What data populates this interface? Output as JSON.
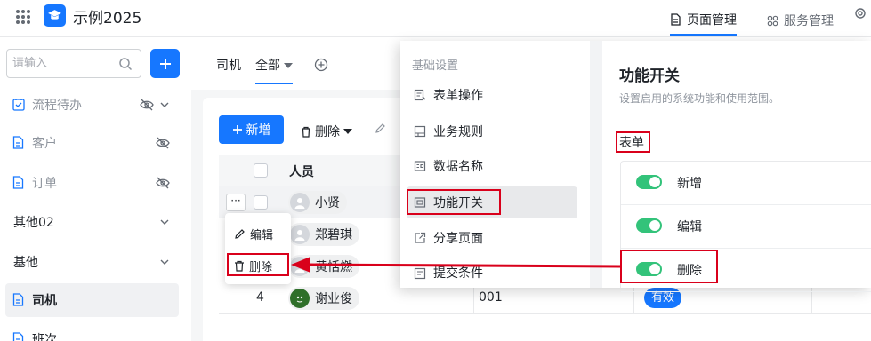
{
  "app": {
    "title": "示例2025"
  },
  "top_tabs": [
    {
      "label": "页面管理",
      "icon": "document-icon"
    },
    {
      "label": "服务管理",
      "icon": "apps-icon"
    }
  ],
  "sidebar": {
    "search_placeholder": "请输入",
    "items": [
      {
        "label": "流程待办",
        "icon": "checklist-icon",
        "hidden": true
      },
      {
        "label": "客户",
        "icon": "document-icon",
        "hidden": true
      },
      {
        "label": "订单",
        "icon": "document-icon",
        "hidden": true
      },
      {
        "label": "其他02"
      },
      {
        "label": "基他"
      },
      {
        "label": "司机",
        "icon": "document-icon"
      },
      {
        "label": "班次",
        "icon": "document-icon"
      }
    ]
  },
  "sub_tabs": {
    "tab1": "司机",
    "tab2": "全部"
  },
  "toolbar": {
    "new_label": "新增",
    "delete_label": "删除"
  },
  "table": {
    "header_person": "人员",
    "rows": [
      {
        "person": "小贤"
      },
      {
        "person": "郑碧琪"
      },
      {
        "person": "黄恬燃"
      },
      {
        "num": "4",
        "person": "谢业俊",
        "code": "001",
        "status": "有效"
      }
    ]
  },
  "row_menu": {
    "edit": "编辑",
    "delete": "删除"
  },
  "settings_nav": {
    "header": "基础设置",
    "items": [
      {
        "label": "表单操作",
        "icon": "form-icon"
      },
      {
        "label": "业务规则",
        "icon": "rule-icon"
      },
      {
        "label": "数据名称",
        "icon": "data-name-icon"
      },
      {
        "label": "功能开关",
        "icon": "switch-icon"
      },
      {
        "label": "分享页面",
        "icon": "share-icon"
      },
      {
        "label": "提交条件",
        "icon": "condition-icon"
      }
    ]
  },
  "settings_panel": {
    "title": "功能开关",
    "subtitle": "设置启用的系统功能和使用范围。",
    "section": "表单",
    "toggles": [
      {
        "label": "新增",
        "on": true
      },
      {
        "label": "编辑",
        "on": true
      },
      {
        "label": "删除",
        "on": true
      }
    ]
  },
  "colors": {
    "accent": "#1677ff",
    "toggle_on": "#33c37a",
    "annotation": "#d9001b"
  }
}
